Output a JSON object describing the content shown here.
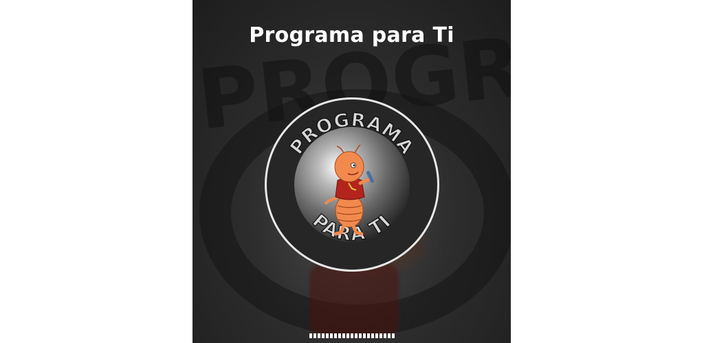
{
  "screen": {
    "title": "Programa para Ti"
  },
  "logo": {
    "top_text": "PROGRAMA",
    "bottom_text": "PARA TI"
  },
  "background": {
    "watermark_text": "PROGRA"
  },
  "loading": {
    "progress_percent": 100
  },
  "colors": {
    "background_dark": "#2d2d2d",
    "title_text": "#ffffff",
    "ring_border": "#e9e9e9",
    "character_orange": "#f28a4e",
    "character_shirt": "#b3241c"
  }
}
